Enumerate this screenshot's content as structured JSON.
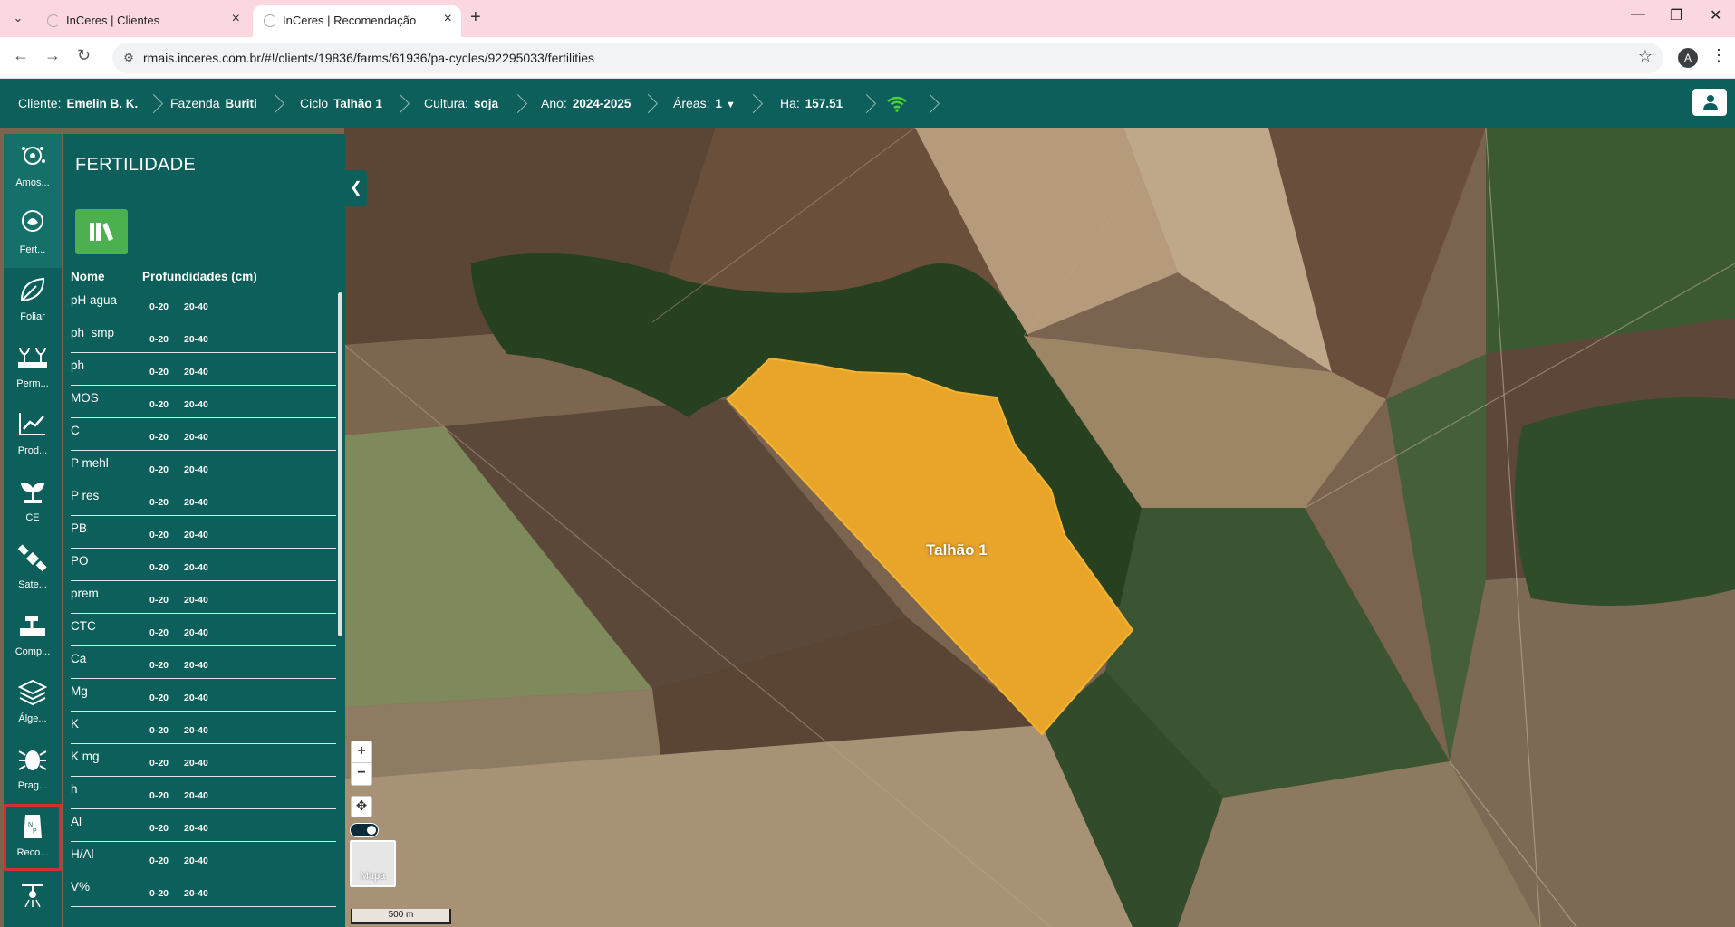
{
  "browser": {
    "tabs": [
      {
        "title": "InCeres | Clientes",
        "active": false
      },
      {
        "title": "InCeres | Recomendação",
        "active": true
      }
    ],
    "url": "rmais.inceres.com.br/#!/clients/19836/farms/61936/pa-cycles/92295033/fertilities",
    "profile_initial": "A"
  },
  "header": {
    "cliente_label": "Cliente:",
    "cliente_value": "Emelin B. K.",
    "fazenda_label": "Fazenda",
    "fazenda_value": "Buriti",
    "ciclo_label": "Ciclo",
    "ciclo_value": "Talhão 1",
    "cultura_label": "Cultura:",
    "cultura_value": "soja",
    "ano_label": "Ano:",
    "ano_value": "2024-2025",
    "areas_label": "Áreas:",
    "areas_value": "1",
    "ha_label": "Ha:",
    "ha_value": "157.51"
  },
  "rail": [
    {
      "label": "Amos...",
      "icon": "sampling-icon"
    },
    {
      "label": "Fert...",
      "icon": "fertility-icon"
    },
    {
      "label": "Foliar",
      "icon": "leaf-icon"
    },
    {
      "label": "Perm...",
      "icon": "plants-icon"
    },
    {
      "label": "Prod...",
      "icon": "chart-icon"
    },
    {
      "label": "CE",
      "icon": "sprout-icon"
    },
    {
      "label": "Sate...",
      "icon": "satellite-icon"
    },
    {
      "label": "Comp...",
      "icon": "soil-compaction-icon"
    },
    {
      "label": "Álge...",
      "icon": "layers-icon"
    },
    {
      "label": "Prag...",
      "icon": "bug-icon"
    },
    {
      "label": "Reco...",
      "icon": "fertilizer-bag-icon"
    }
  ],
  "panel": {
    "title": "FERTILIDADE",
    "col_name": "Nome",
    "col_depths": "Profundidades (cm)",
    "depth1": "0-20",
    "depth2": "20-40",
    "rows": [
      "pH agua",
      "ph_smp",
      "ph",
      "MOS",
      "C",
      "P mehl",
      "P res",
      "PB",
      "PO",
      "prem",
      "CTC",
      "Ca",
      "Mg",
      "K",
      "K mg",
      "h",
      "Al",
      "H/Al",
      "V%"
    ]
  },
  "map": {
    "field_label": "Talhão 1",
    "basemap_label": "Mapa",
    "scale_label": "500 m",
    "field_color": "#e9a52a"
  }
}
